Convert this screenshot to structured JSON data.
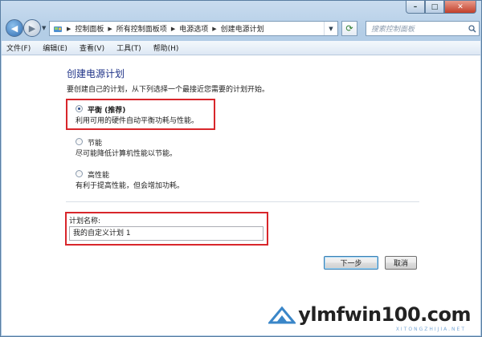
{
  "breadcrumb": {
    "items": [
      "控制面板",
      "所有控制面板项",
      "电源选项",
      "创建电源计划"
    ]
  },
  "search": {
    "placeholder": "搜索控制面板"
  },
  "menubar": {
    "items": [
      "文件(F)",
      "编辑(E)",
      "查看(V)",
      "工具(T)",
      "帮助(H)"
    ]
  },
  "page": {
    "heading": "创建电源计划",
    "intro": "要创建自己的计划，从下列选择一个最接近您需要的计划开始。"
  },
  "options": [
    {
      "title": "平衡 (推荐)",
      "desc": "利用可用的硬件自动平衡功耗与性能。",
      "checked": true
    },
    {
      "title": "节能",
      "desc": "尽可能降低计算机性能以节能。",
      "checked": false
    },
    {
      "title": "高性能",
      "desc": "有利于提高性能，但会增加功耗。",
      "checked": false
    }
  ],
  "plan_name": {
    "label": "计划名称:",
    "value": "我的自定义计划 1"
  },
  "buttons": {
    "next": "下一步",
    "cancel": "取消"
  },
  "watermark": {
    "text": "ylmfwin100.com",
    "sub": "XITONGZHIJIA.NET"
  },
  "colors": {
    "highlight_box": "#d8262b",
    "heading": "#1e3287"
  }
}
